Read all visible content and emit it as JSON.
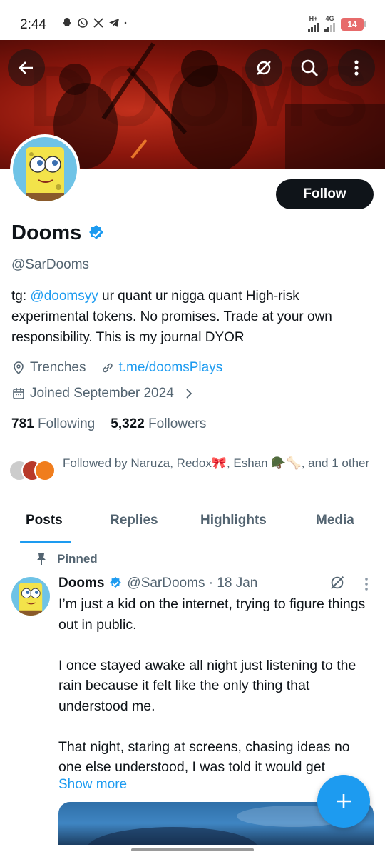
{
  "status_bar": {
    "time": "2:44",
    "network_label": "H+",
    "network_label_2": "4G",
    "battery": "14"
  },
  "header": {
    "banner_word": "DOOMS",
    "icons": [
      "back-arrow-icon",
      "grok-icon",
      "search-icon",
      "more-vertical-icon"
    ]
  },
  "profile": {
    "follow_label": "Follow",
    "display_name": "Dooms",
    "handle": "@SarDooms",
    "bio_prefix": "tg: ",
    "bio_mention": "@doomsyy",
    "bio_rest": " ur quant  ur nigga quant High-risk experimental tokens. No promises. Trade at your own responsibility.  This is my journal  DYOR",
    "location": "Trenches",
    "website": "t.me/doomsPlays",
    "joined": "Joined September 2024",
    "following_count": "781",
    "following_label": "Following",
    "followers_count": "5,322",
    "followers_label": "Followers",
    "followed_by": "Followed by Naruza, Redox🎀, Eshan 🪖🦴, and 1 other"
  },
  "tabs": [
    {
      "label": "Posts",
      "active": true
    },
    {
      "label": "Replies",
      "active": false
    },
    {
      "label": "Highlights",
      "active": false
    },
    {
      "label": "Media",
      "active": false
    }
  ],
  "post": {
    "pinned_label": "Pinned",
    "author": "Dooms",
    "handle_date": "@SarDooms · 18 Jan",
    "text": "I’m just a kid on the internet, trying to figure things out in public.\n\nI once stayed awake all night just listening to the rain because it felt like the only thing that understood me.\n\nThat night, staring at screens, chasing ideas no one else understood, I was told it would get",
    "show_more": "Show more"
  },
  "colors": {
    "accent": "#1d9bf0",
    "text_primary": "#0f1419",
    "text_secondary": "#536471",
    "follow_button": "#0f1419",
    "banner_red": "#c2301c"
  }
}
